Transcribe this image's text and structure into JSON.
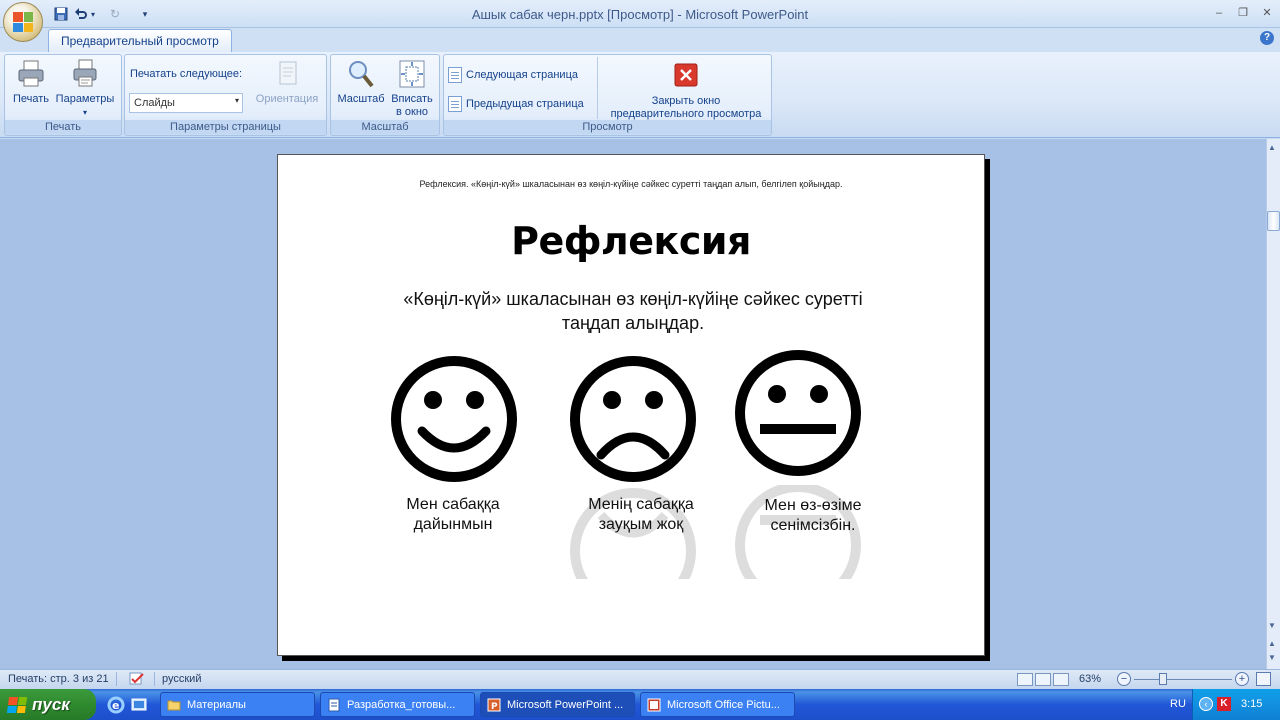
{
  "window": {
    "title": "Ашык сабак черн.pptx [Просмотр] - Microsoft PowerPoint",
    "controls": [
      "minimize",
      "restore",
      "close"
    ]
  },
  "ribbon": {
    "tab": "Предварительный просмотр",
    "groups": {
      "print": {
        "label": "Печать",
        "print_btn": "Печать",
        "params_btn": "Параметры"
      },
      "page_setup": {
        "label": "Параметры страницы",
        "print_what_label": "Печатать следующее:",
        "print_what_value": "Слайды",
        "orientation_btn": "Ориентация"
      },
      "zoom": {
        "label": "Масштаб",
        "zoom_btn": "Масштаб",
        "fit_btn_line1": "Вписать",
        "fit_btn_line2": "в окно"
      },
      "preview": {
        "label": "Просмотр",
        "next_page": "Следующая страница",
        "prev_page": "Предыдущая страница",
        "close_line1": "Закрыть окно",
        "close_line2": "предварительного просмотра"
      }
    }
  },
  "page": {
    "header": "Рефлексия. «Көңіл-күй» шкаласынан өз көңіл-күйіңе сәйкес суреттi таңдап алып, белгiлеп қойыңдар.",
    "title": "Рефлексия",
    "subtitle_line1": "«Көңіл-күй» шкаласынан  өз көңіл-күйіңе сәйкес суретті",
    "subtitle_line2": "таңдап алыңдар.",
    "faces": [
      {
        "type": "happy",
        "caption_line1": "Мен сабаққа",
        "caption_line2": "дайынмын"
      },
      {
        "type": "sad",
        "caption_line1": "Менің сабаққа",
        "caption_line2": "зауқым жоқ"
      },
      {
        "type": "neutral",
        "caption_line1": "Мен өз-өзіме",
        "caption_line2": "сенімсізбін."
      }
    ]
  },
  "statusbar": {
    "page_info": "Печать: стр. 3 из 21",
    "language": "русский",
    "zoom": "63%"
  },
  "taskbar": {
    "start": "пуск",
    "tasks": [
      {
        "label": "Материалы"
      },
      {
        "label": "Разработка_готовы..."
      },
      {
        "label": "Microsoft PowerPoint ..."
      },
      {
        "label": "Microsoft Office Pictu..."
      }
    ],
    "lang": "RU",
    "clock": "3:15"
  }
}
